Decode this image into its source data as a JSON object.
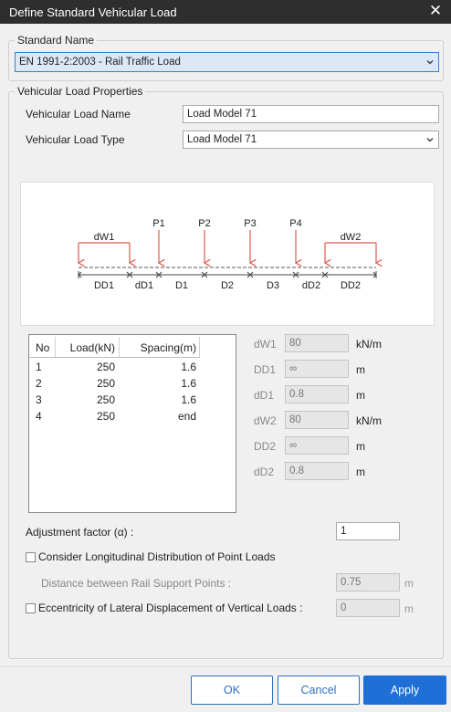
{
  "window": {
    "title": "Define Standard Vehicular Load"
  },
  "standard": {
    "group_label": "Standard Name",
    "selected": "EN 1991-2:2003 - Rail Traffic Load"
  },
  "properties": {
    "group_label": "Vehicular Load Properties",
    "name_label": "Vehicular Load Name",
    "name_value": "Load Model 71",
    "type_label": "Vehicular Load Type",
    "type_value": "Load Model 71"
  },
  "diagram": {
    "point_loads": [
      "P1",
      "P2",
      "P3",
      "P4"
    ],
    "distributed": [
      "dW1",
      "dW2"
    ],
    "dimensions": [
      "DD1",
      "dD1",
      "D1",
      "D2",
      "D3",
      "dD2",
      "DD2"
    ],
    "load_color": "#e05a4e"
  },
  "load_table": {
    "headers": [
      "No",
      "Load(kN)",
      "Spacing(m)"
    ],
    "rows": [
      [
        "1",
        "250",
        "1.6"
      ],
      [
        "2",
        "250",
        "1.6"
      ],
      [
        "3",
        "250",
        "1.6"
      ],
      [
        "4",
        "250",
        "end"
      ]
    ]
  },
  "params": [
    {
      "label": "dW1",
      "value": "80",
      "unit": "kN/m"
    },
    {
      "label": "DD1",
      "value": "∞",
      "unit": "m"
    },
    {
      "label": "dD1",
      "value": "0.8",
      "unit": "m"
    },
    {
      "label": "dW2",
      "value": "80",
      "unit": "kN/m"
    },
    {
      "label": "DD2",
      "value": "∞",
      "unit": "m"
    },
    {
      "label": "dD2",
      "value": "0.8",
      "unit": "m"
    }
  ],
  "adjustment": {
    "label": "Adjustment factor (α) :",
    "value": "1"
  },
  "longitudinal": {
    "label": "Consider Longitudinal Distribution of Point Loads",
    "checked": false,
    "distance_label": "Distance between Rail Support Points :",
    "distance_value": "0.75",
    "distance_unit": "m"
  },
  "eccentricity": {
    "label": "Eccentricity of Lateral Displacement of Vertical Loads :",
    "checked": false,
    "value": "0",
    "unit": "m"
  },
  "buttons": {
    "ok": "OK",
    "cancel": "Cancel",
    "apply": "Apply"
  },
  "colors": {
    "accent": "#1f6fd6",
    "titlebar": "#2e2e2e",
    "selection": "#dbe8f7"
  }
}
